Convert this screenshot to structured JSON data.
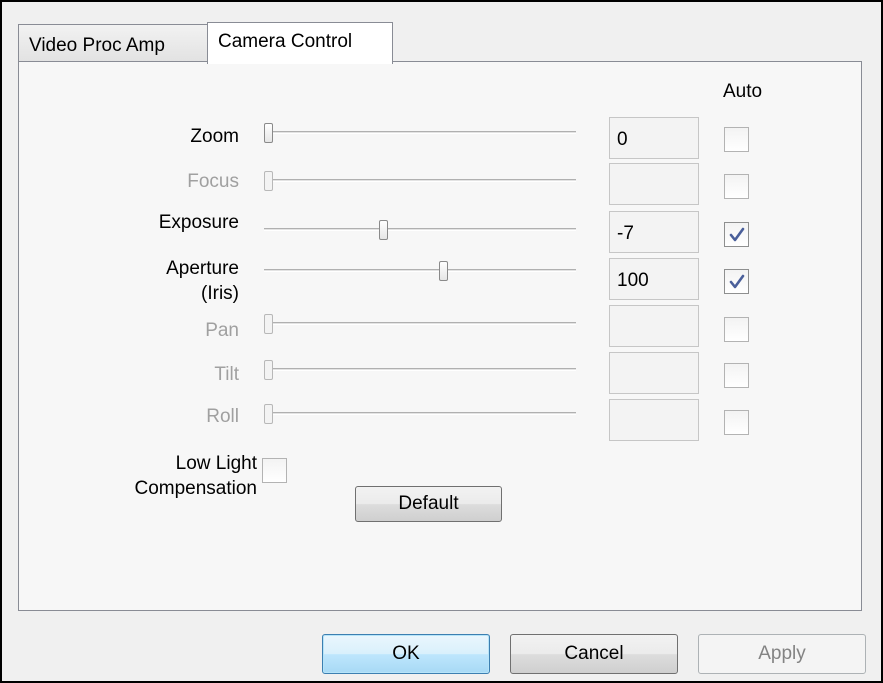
{
  "tabs": [
    {
      "label": "Video Proc Amp",
      "active": false
    },
    {
      "label": "Camera Control",
      "active": true
    }
  ],
  "auto_header": "Auto",
  "controls": [
    {
      "label": "Zoom",
      "enabled": true,
      "value": "0",
      "slider_fraction": 0.0,
      "auto": false
    },
    {
      "label": "Focus",
      "enabled": false,
      "value": "",
      "slider_fraction": 0.0,
      "auto": false
    },
    {
      "label": "Exposure",
      "enabled": true,
      "value": "-7",
      "slider_fraction": 0.38,
      "auto": true
    },
    {
      "label_line1": "Aperture",
      "label_line2": "(Iris)",
      "enabled": true,
      "value": "100",
      "slider_fraction": 0.58,
      "auto": true
    },
    {
      "label": "Pan",
      "enabled": false,
      "value": "",
      "slider_fraction": 0.0,
      "auto": false
    },
    {
      "label": "Tilt",
      "enabled": false,
      "value": "",
      "slider_fraction": 0.0,
      "auto": false
    },
    {
      "label": "Roll",
      "enabled": false,
      "value": "",
      "slider_fraction": 0.0,
      "auto": false
    }
  ],
  "low_light": {
    "line1": "Low Light",
    "line2": "Compensation",
    "checked": false
  },
  "buttons": {
    "default": "Default",
    "ok": "OK",
    "cancel": "Cancel",
    "apply": "Apply"
  },
  "colors": {
    "check_mark": "#4a5f9a",
    "focus_border": "#3c7fb1",
    "disabled_text": "#a0a0a0"
  },
  "icons": {
    "check": "check-icon"
  }
}
